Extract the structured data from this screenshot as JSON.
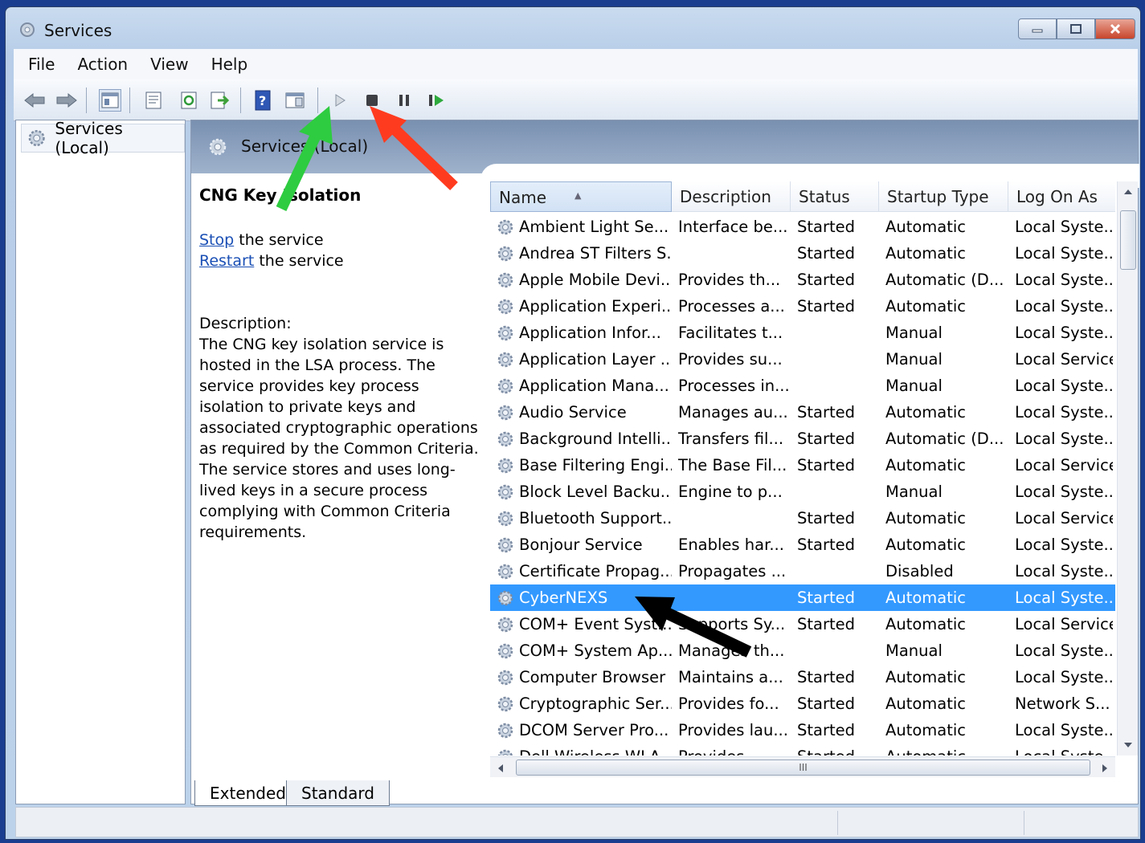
{
  "window": {
    "title": "Services"
  },
  "menu": [
    "File",
    "Action",
    "View",
    "Help"
  ],
  "toolbar": [
    "back",
    "forward",
    "console-tree",
    "properties",
    "refresh",
    "export-list",
    "help",
    "show-pane",
    "start-service",
    "stop-service",
    "pause-service",
    "resume-service"
  ],
  "tree": {
    "root_label": "Services (Local)"
  },
  "header": {
    "label": "Services (Local)"
  },
  "details": {
    "service_name": "CNG Key Isolation",
    "stop_link": "Stop",
    "stop_suffix": " the service",
    "restart_link": "Restart",
    "restart_suffix": " the service",
    "description_label": "Description:",
    "description_text": "The CNG key isolation service is hosted in the LSA process. The service provides key process isolation to private keys and associated cryptographic operations as required by the Common Criteria. The service stores and uses long-lived keys in a secure process complying with Common Criteria requirements."
  },
  "columns": [
    "Name",
    "Description",
    "Status",
    "Startup Type",
    "Log On As"
  ],
  "rows": [
    [
      "Ambient Light Se...",
      "Interface be...",
      "Started",
      "Automatic",
      "Local Syste..."
    ],
    [
      "Andrea ST Filters S...",
      "",
      "Started",
      "Automatic",
      "Local Syste..."
    ],
    [
      "Apple Mobile Devi...",
      "Provides th...",
      "Started",
      "Automatic (D...",
      "Local Syste..."
    ],
    [
      "Application Experi...",
      "Processes a...",
      "Started",
      "Automatic",
      "Local Syste..."
    ],
    [
      "Application Infor...",
      "Facilitates t...",
      "",
      "Manual",
      "Local Syste..."
    ],
    [
      "Application Layer ...",
      "Provides su...",
      "",
      "Manual",
      "Local Service"
    ],
    [
      "Application Mana...",
      "Processes in...",
      "",
      "Manual",
      "Local Syste..."
    ],
    [
      "Audio Service",
      "Manages au...",
      "Started",
      "Automatic",
      "Local Syste..."
    ],
    [
      "Background Intelli...",
      "Transfers fil...",
      "Started",
      "Automatic (D...",
      "Local Syste..."
    ],
    [
      "Base Filtering Engi...",
      "The Base Fil...",
      "Started",
      "Automatic",
      "Local Service"
    ],
    [
      "Block Level Backu...",
      "Engine to p...",
      "",
      "Manual",
      "Local Syste..."
    ],
    [
      "Bluetooth Support...",
      "",
      "Started",
      "Automatic",
      "Local Service"
    ],
    [
      "Bonjour Service",
      "Enables har...",
      "Started",
      "Automatic",
      "Local Syste..."
    ],
    [
      "Certificate Propag...",
      "Propagates ...",
      "",
      "Disabled",
      "Local Syste..."
    ],
    [
      "CyberNEXS",
      "",
      "Started",
      "Automatic",
      "Local Syste..."
    ],
    [
      "COM+ Event Syst...",
      "Supports Sy...",
      "Started",
      "Automatic",
      "Local Service"
    ],
    [
      "COM+ System Ap...",
      "Manages th...",
      "",
      "Manual",
      "Local Syste..."
    ],
    [
      "Computer Browser",
      "Maintains a...",
      "Started",
      "Automatic",
      "Local Syste..."
    ],
    [
      "Cryptographic Ser...",
      "Provides fo...",
      "Started",
      "Automatic",
      "Network S..."
    ],
    [
      "DCOM Server Pro...",
      "Provides lau...",
      "Started",
      "Automatic",
      "Local Syste..."
    ],
    [
      "Dell Wireless WLA...",
      "Provides...",
      "Started",
      "Automatic",
      "Local Syste..."
    ]
  ],
  "selected_row": 14,
  "tabs": [
    "Extended",
    "Standard"
  ],
  "scroll": {
    "h_thumb": "III"
  },
  "colors": {
    "selection": "#3399ff",
    "link": "#1a4fb5",
    "arrow_green": "#2ecc40",
    "arrow_red": "#ff3b1f",
    "arrow_black": "#000000"
  }
}
